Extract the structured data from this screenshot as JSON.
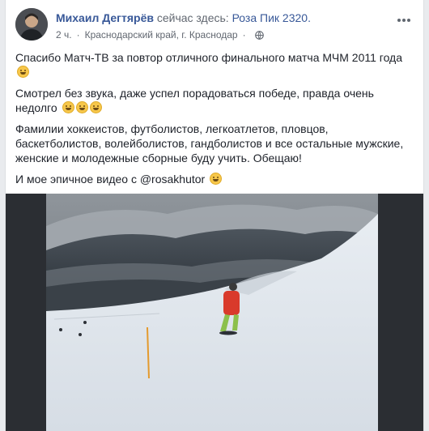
{
  "post": {
    "author": "Михаил Дегтярёв",
    "checkin_text": "сейчас здесь:",
    "place": "Роза Пик 2320.",
    "time": "2 ч.",
    "location": "Краснодарский край, г. Краснодар",
    "paragraphs": [
      "Спасибо Матч-ТВ за повтор отличного финального матча МЧМ 2011 года",
      "Смотрел без звука, даже успел порадоваться победе, правда очень недолго",
      "Фамилии хоккеистов, футболистов, легкоатлетов, пловцов, баскетболистов, волейболистов, гандболистов и все остальные мужские, женские и молодежные сборные буду учить. Обещаю!",
      "И мое эпичное видео с @rosakhutor"
    ]
  },
  "icons": {
    "menu": "more-options-icon",
    "privacy": "globe-icon",
    "emoji": "grinning-face-emoji"
  },
  "colors": {
    "link": "#385898",
    "text": "#1d2129",
    "secondary": "#616770",
    "background": "#e9ebee"
  }
}
